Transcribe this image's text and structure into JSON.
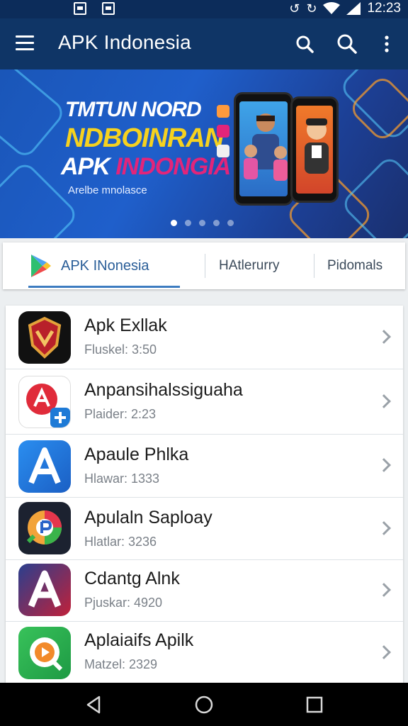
{
  "status_bar": {
    "time": "12:23"
  },
  "app_bar": {
    "title": "APK Indonesia"
  },
  "banner": {
    "line1": "TMTUN NORD",
    "line2": "NDBOINRAN",
    "line3_a": "APK ",
    "line3_b": "INDONGIA",
    "subtitle": "Arelbe mnolasce",
    "active_dot": 0,
    "dot_count": 5
  },
  "tabs": [
    {
      "label": "APK INonesia"
    },
    {
      "label": "HAtlerurry"
    },
    {
      "label": "Pidomals"
    }
  ],
  "apps": [
    {
      "name": "Apk Exllak",
      "meta": "Fluskel: 3:50",
      "icon": "shield-emblem-icon"
    },
    {
      "name": "Anpansihalssiguaha",
      "meta": "Plaider: 2:23",
      "icon": "translate-plus-icon"
    },
    {
      "name": "Apaule Phlka",
      "meta": "Hlawar: 1333",
      "icon": "letter-a-icon"
    },
    {
      "name": "Apulaln Saploay",
      "meta": "Hlatlar: 3236",
      "icon": "chat-bubble-icon"
    },
    {
      "name": "Cdantg Alnk",
      "meta": "Pjuskar: 4920",
      "icon": "letter-a-red-icon"
    },
    {
      "name": "Aplaiaifs Apilk",
      "meta": "Matzel: 2329",
      "icon": "chat-play-icon"
    }
  ],
  "colors": {
    "app_bar": "#0f3566",
    "status_bar": "#0c2c5a",
    "tab_accent": "#3d7cc0",
    "banner_yellow": "#f6d21f",
    "banner_pink": "#e2257a"
  }
}
